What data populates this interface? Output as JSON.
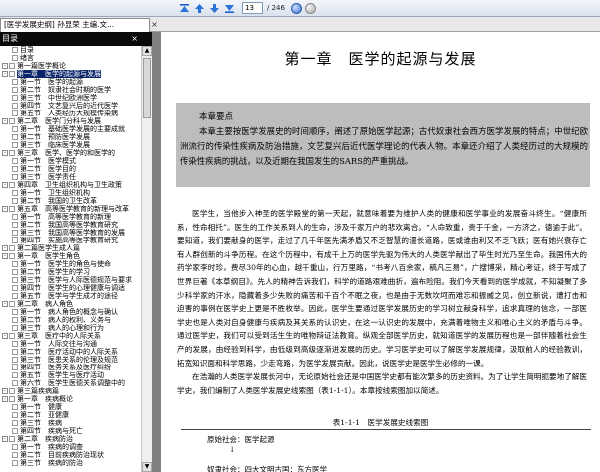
{
  "toolbar": {
    "page_value": "13",
    "page_total": "/ 246"
  },
  "tab": {
    "title": "[医学发展史纲] 孙显荣 主编.文...",
    "close": "×"
  },
  "sidebar": {
    "header": "目录",
    "close": "×",
    "items": [
      {
        "box": "",
        "text": "目录"
      },
      {
        "box": "",
        "text": "绪言"
      },
      {
        "box": "-",
        "text": "第一篇医学概论"
      },
      {
        "box": "-",
        "text": "第一章　医学的起源与发展",
        "selected": true
      },
      {
        "box": "",
        "text": "第一节　医学的起源"
      },
      {
        "box": "",
        "text": "第二节　奴隶社会时期的医学"
      },
      {
        "box": "",
        "text": "第三节　中世纪欧洲医学"
      },
      {
        "box": "",
        "text": "第四节　文艺复兴后的近代医学"
      },
      {
        "box": "",
        "text": "第五节　人类经历大规模传染病"
      },
      {
        "box": "-",
        "text": "第二章　医学门分科与发展"
      },
      {
        "box": "",
        "text": "第一节　基础医学发展的主要成就"
      },
      {
        "box": "",
        "text": "第二节　预防医学发展"
      },
      {
        "box": "",
        "text": "第三节　临床医学发展"
      },
      {
        "box": "-",
        "text": "第三章　医学、医学的和医学的"
      },
      {
        "box": "",
        "text": "第一节　医学模式"
      },
      {
        "box": "",
        "text": "第二节　医学目的"
      },
      {
        "box": "",
        "text": "第三节　医学责任"
      },
      {
        "box": "-",
        "text": "第四章　卫生组织机构与卫生政策"
      },
      {
        "box": "",
        "text": "第一节　卫生组织机构"
      },
      {
        "box": "",
        "text": "第二节　我国的卫生改革"
      },
      {
        "box": "-",
        "text": "第五章　高等医学教育的新理与改革"
      },
      {
        "box": "",
        "text": "第一节　高等医学教育的新理"
      },
      {
        "box": "",
        "text": "第二节　我国高等医学教育研究"
      },
      {
        "box": "",
        "text": "第三节　我国高等医学教育的发展"
      },
      {
        "box": "",
        "text": "第四节　实施高等医学教育研究"
      },
      {
        "box": "-",
        "text": "第二篇医学生成人篇"
      },
      {
        "box": "-",
        "text": "第一章　医学生角色"
      },
      {
        "box": "",
        "text": "第一节　医学生的角色与使命"
      },
      {
        "box": "",
        "text": "第二节　医学生的学习"
      },
      {
        "box": "",
        "text": "第三节　医学与人际医德规范与要求"
      },
      {
        "box": "",
        "text": "第四节　医学生的心理健康与调适"
      },
      {
        "box": "",
        "text": "第五节　医学与学生成才的途径"
      },
      {
        "box": "-",
        "text": "第二章　病人角色"
      },
      {
        "box": "",
        "text": "第一节　病人角色的概念与确认"
      },
      {
        "box": "",
        "text": "第二节　病人的权利、义务与"
      },
      {
        "box": "",
        "text": "第三节　病人的心理和行为"
      },
      {
        "box": "-",
        "text": "第三章　医疗中的人际关系"
      },
      {
        "box": "",
        "text": "第一节　人际交往与沟通"
      },
      {
        "box": "",
        "text": "第二节　医疗活动中的人际关系"
      },
      {
        "box": "",
        "text": "第三节　医患关系的伦理及规范"
      },
      {
        "box": "",
        "text": "第四节　医务关系及医疗纠纷"
      },
      {
        "box": "",
        "text": "第五节　医学生与医疗活动"
      },
      {
        "box": "",
        "text": "第六节　医学生医德关系调整中的"
      },
      {
        "box": "-",
        "text": "第三篇疾病篇"
      },
      {
        "box": "-",
        "text": "第一章　疾病概论"
      },
      {
        "box": "",
        "text": "第一节　健康"
      },
      {
        "box": "",
        "text": "第二节　亚健康"
      },
      {
        "box": "",
        "text": "第三节　疾病"
      },
      {
        "box": "",
        "text": "第四节　疾病与死亡"
      },
      {
        "box": "-",
        "text": "第二章　疾病防治"
      },
      {
        "box": "",
        "text": "第一节　疾病的调查"
      },
      {
        "box": "",
        "text": "第二节　目前疾病防治现状"
      },
      {
        "box": "",
        "text": "第三节　疾病的防治"
      }
    ]
  },
  "page": {
    "chapter_title": "第一章　医学的起源与发展",
    "summary_title": "本章要点",
    "summary_body": "本章主要按医学发展史的时间顺序，阐述了原始医学起源；古代奴隶社会西方医学发展的特点；中世纪欧洲流行的传染性疾病及防治措施，文艺复兴后近代医学理论的代表人物。本章还介绍了人类经历过的大规模的传染性疾病的挑战，以及近期在我国发生的SARS的严重挑战。",
    "paragraphs": [
      "医学生，当他步入神圣的医学殿堂的第一天起，就意味着要为维护人类的健康和医学事业的发展奋斗终生。“健康所系，性命相托”。医生的工作关系到人的生命，涉及千家万户的悲欢离合。“人命致重，贵于千金，一方济之，德逾于此”。要知道，我们要献身的医学，走过了几千年医先满矛盾又不乏智慧的漫长道路，医或谁由利又不乏飞跃；医有她兴衰存亡有人群创新的斗争历程。在这个历程中，有成千上万的医学先驱为伟大的人类医学献出了毕生时光乃至生命。我国伟大的药学家李时珍，费尽30年的心血，越千重山，行万里路，“书考八百余家，稿凡三易”，广搜博采，精心考证，终于写成了世界巨著《本草纲目》。先人的精神告诉我们，科学的道路艰难曲折，遍布险阻。我们今天看到的医学成就，不知凝聚了多少科学家的汗水，隐藏着多少失败的痛苦和千百个不眠之夜，也是由于无数坎坷而难忘和振威之见，创立新说，遭打击和迫害的事例在医学史上更是不胜枚举。因此，医学生要通过医学发展历史的学习树立献身科学，追求真理的信念，一部医学史也是人类对自身健康与疾病及其关系的认识史，在这一认识史的发展中，充满着唯物主义和唯心主义的矛盾与斗争。通过医学史，我们可以受到活生生的唯物辩证法教育。纵观全部医学历史，就知道医学的发展历程也是一部伴随着社会生产的发展，由经验到科学，由低级到高级逐渐进发展的历史。学习医学史可以了解医学发展规律，汲取前人的经验教训，拓宽知识面和科学思路，少走弯路，为医学发展贡献。因此，说医学史是医学生必修的一课。",
      "在浩瀚的人类医学发展长河中，无论原始社会还是中国医学史都有能次繁多的历史资料。为了让学生简明扼要地了解医学史，我们编制了人类医学发展史线索图（表1-1-1）。本章按线索图加以简述。"
    ],
    "table_caption": "表1-1-1　医学发展史线索图",
    "table_line1": "原始社会：医学起源",
    "table_arrow": "↓",
    "table_line2": "奴隶社会：四大文明古国：东方医学"
  }
}
